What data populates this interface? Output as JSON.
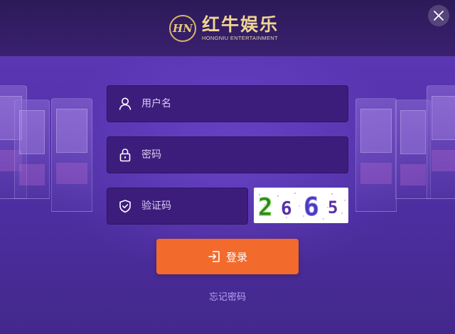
{
  "header": {
    "logo_badge": "HN",
    "logo_cn": "红牛娱乐",
    "logo_en": "HONGNIU ENTERTAINMENT"
  },
  "form": {
    "username_placeholder": "用户名",
    "password_placeholder": "密码",
    "captcha_placeholder": "验证码",
    "captcha_code": "2665",
    "login_label": "登录",
    "forgot_label": "忘记密码"
  },
  "colors": {
    "accent": "#f26a2c",
    "field_bg": "#3d1d7c",
    "logo_gold": "#f0d593"
  }
}
